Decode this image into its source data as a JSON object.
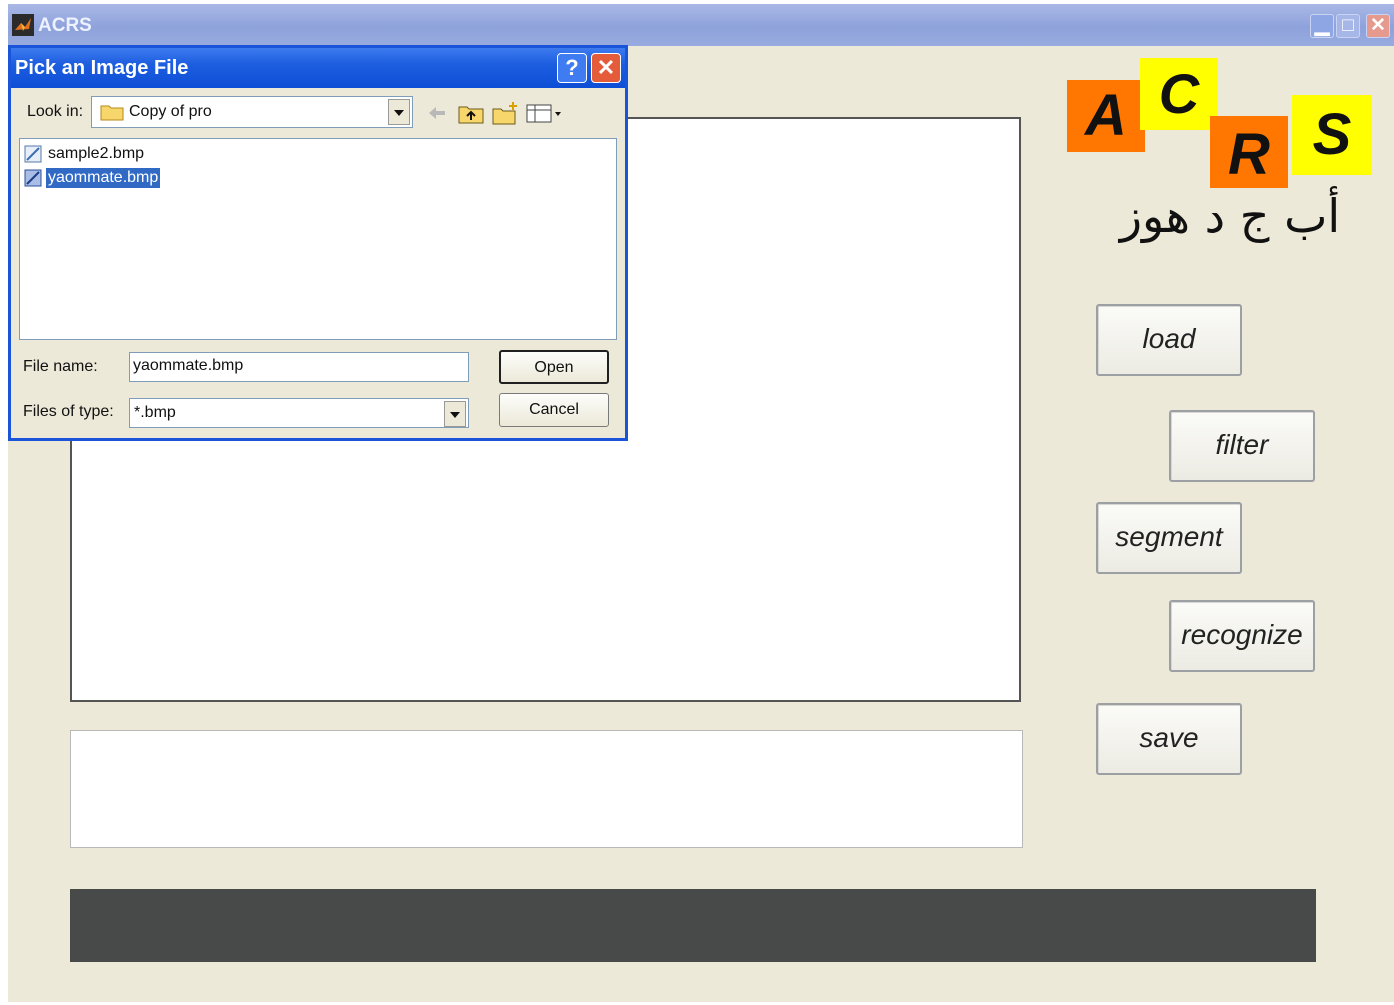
{
  "main_window": {
    "title": "ACRS"
  },
  "logo": {
    "letters": [
      "A",
      "C",
      "R",
      "S"
    ],
    "arabic_text": "أب ج د هوز",
    "colors": {
      "orange": "#ff7700",
      "yellow": "#ffff00"
    }
  },
  "buttons": {
    "load": "load",
    "filter": "filter",
    "segment": "segment",
    "recognize": "recognize",
    "save": "save"
  },
  "dialog": {
    "title": "Pick an Image File",
    "help_label": "?",
    "close_label": "✕",
    "look_in_label": "Look in:",
    "look_in_value": "Copy of pro",
    "files": [
      {
        "name": "sample2.bmp",
        "selected": false
      },
      {
        "name": "yaommate.bmp",
        "selected": true
      }
    ],
    "file_name_label": "File name:",
    "file_name_value": "yaommate.bmp",
    "file_type_label": "Files of type:",
    "file_type_value": "*.bmp",
    "open_label": "Open",
    "cancel_label": "Cancel"
  },
  "icons": {
    "app": "matlab-icon",
    "folder": "folder-icon",
    "file": "bitmap-file-icon",
    "back": "back-arrow-icon",
    "up": "up-folder-icon",
    "new_folder": "new-folder-icon",
    "view": "view-menu-icon"
  },
  "colors": {
    "window_bg": "#ece9d8",
    "dialog_titlebar": "#0d4ed6",
    "selection": "#316ac5",
    "status_bar": "#484a4a"
  }
}
